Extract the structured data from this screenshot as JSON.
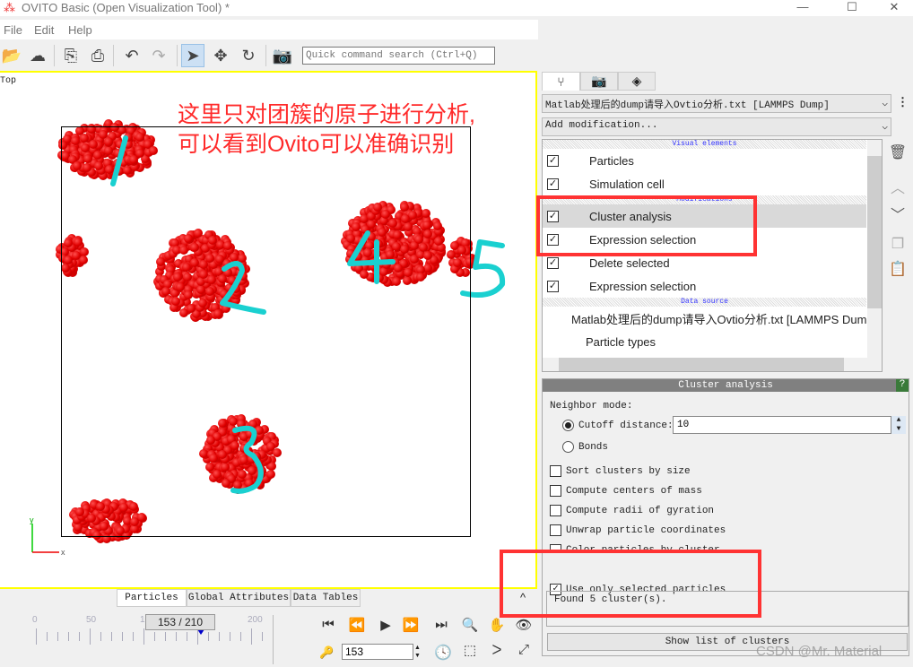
{
  "window": {
    "title": "OVITO Basic (Open Visualization Tool) *",
    "minimize": "—",
    "maximize": "☐",
    "close": "✕"
  },
  "menu": [
    "File",
    "Edit",
    "Help"
  ],
  "toolbar": {
    "icons": [
      "open-file",
      "download",
      "import",
      "export",
      "undo",
      "redo",
      "select",
      "move",
      "rotate",
      "screenshot"
    ],
    "search_placeholder": "Quick command search (Ctrl+Q)"
  },
  "viewport": {
    "label": "Top",
    "axis_x": "x",
    "axis_y": "y",
    "annotation_line1": "这里只对团簇的原子进行分析,",
    "annotation_line2": "可以看到Ovito可以准确识别",
    "cluster_colors": {
      "atom": "#e00000",
      "handwriting": "#1ad0d0",
      "highlight": "#ff3333",
      "border": "#ffff00"
    }
  },
  "pipeline": {
    "tabs": [
      "pipeline",
      "render",
      "layers"
    ],
    "source_combo": "Matlab处理后的dump请导入Ovtio分析.txt [LAMMPS Dump]",
    "add_modification": "Add modification...",
    "sections": {
      "visual": "Visual elements",
      "mods": "Modifications",
      "data": "Data source"
    },
    "visual_items": [
      {
        "label": "Particles",
        "checked": true
      },
      {
        "label": "Simulation cell",
        "checked": true
      }
    ],
    "mod_items": [
      {
        "label": "Cluster analysis",
        "checked": true,
        "selected": true
      },
      {
        "label": "Expression selection",
        "checked": true
      },
      {
        "label": "Delete selected",
        "checked": true
      },
      {
        "label": "Expression selection",
        "checked": true
      }
    ],
    "data_items": [
      "Matlab处理后的dump请导入Ovtio分析.txt [LAMMPS Dump",
      "Particle types"
    ]
  },
  "panel": {
    "title": "Cluster analysis",
    "help": "?",
    "neighbor_mode": "Neighbor mode:",
    "cutoff_label": "Cutoff distance:",
    "cutoff_value": "10",
    "bonds_label": "Bonds",
    "options": [
      {
        "label": "Sort clusters by size",
        "checked": false
      },
      {
        "label": "Compute centers of mass",
        "checked": false
      },
      {
        "label": "Compute radii of gyration",
        "checked": false
      },
      {
        "label": "Unwrap particle coordinates",
        "checked": false
      },
      {
        "label": "Color particles by cluster",
        "checked": false
      },
      {
        "label": "Use only selected particles",
        "checked": true
      }
    ],
    "status": "Found 5 cluster(s).",
    "show_list": "Show list of clusters"
  },
  "bottom": {
    "tabs": [
      "Particles",
      "Global Attributes",
      "Data Tables"
    ],
    "ticks": [
      "0",
      "50",
      "100",
      "150",
      "200"
    ],
    "frame_display": "153 / 210",
    "current_frame": 153,
    "total_frames": 210,
    "frame_input": "153"
  },
  "watermark": "CSDN @Mr. Material"
}
